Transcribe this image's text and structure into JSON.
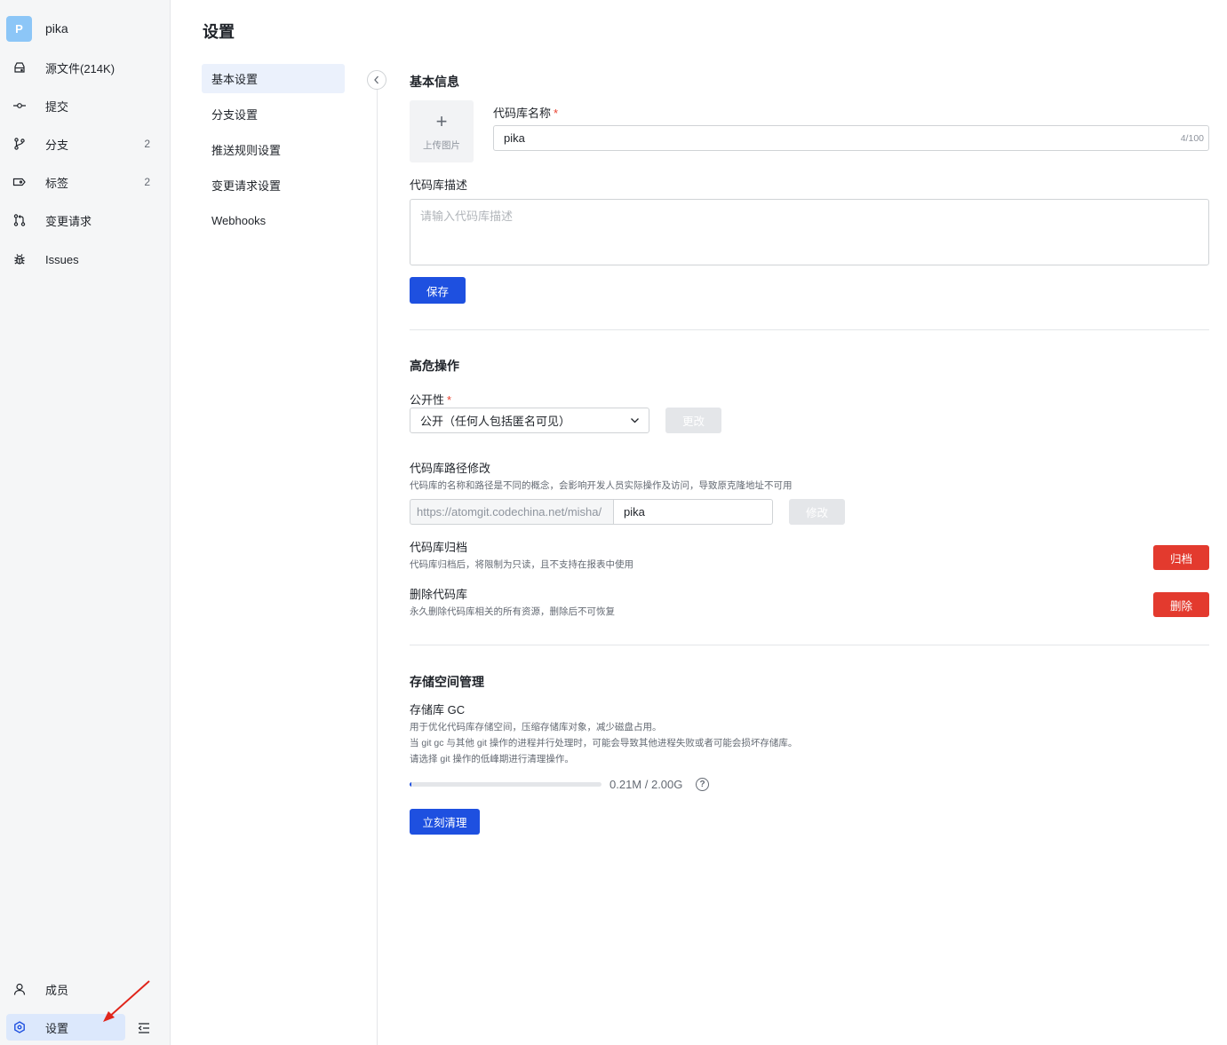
{
  "sidebar": {
    "repo": {
      "avatar_letter": "P",
      "name": "pika"
    },
    "items": [
      {
        "label": "源文件(214K)",
        "count": ""
      },
      {
        "label": "提交",
        "count": ""
      },
      {
        "label": "分支",
        "count": "2"
      },
      {
        "label": "标签",
        "count": "2"
      },
      {
        "label": "变更请求",
        "count": ""
      },
      {
        "label": "Issues",
        "count": ""
      }
    ],
    "bottom": [
      {
        "label": "成员"
      },
      {
        "label": "设置"
      }
    ]
  },
  "page": {
    "title": "设置"
  },
  "subnav": [
    {
      "label": "基本设置",
      "active": true
    },
    {
      "label": "分支设置"
    },
    {
      "label": "推送规则设置"
    },
    {
      "label": "变更请求设置"
    },
    {
      "label": "Webhooks"
    }
  ],
  "basic": {
    "title": "基本信息",
    "upload_plus": "+",
    "upload_label": "上传图片",
    "name_label": "代码库名称",
    "required_mark": "*",
    "name_value": "pika",
    "name_counter": "4/100",
    "desc_label": "代码库描述",
    "desc_placeholder": "请输入代码库描述",
    "save_label": "保存"
  },
  "danger": {
    "title": "高危操作",
    "visibility_label": "公开性",
    "visibility_value": "公开（任何人包括匿名可见）",
    "change_label": "更改",
    "path_title": "代码库路径修改",
    "path_hint": "代码库的名称和路径是不同的概念，会影响开发人员实际操作及访问，导致原克隆地址不可用",
    "path_prefix": "https://atomgit.codechina.net/misha/",
    "path_value": "pika",
    "path_button": "修改",
    "archive_title": "代码库归档",
    "archive_hint": "代码库归档后，将限制为只读，且不支持在报表中使用",
    "archive_button": "归档",
    "delete_title": "删除代码库",
    "delete_hint": "永久删除代码库相关的所有资源，删除后不可恢复",
    "delete_button": "删除"
  },
  "storage": {
    "title": "存储空间管理",
    "gc_title": "存储库 GC",
    "gc_hint_1": "用于优化代码库存储空间，压缩存储库对象，减少磁盘占用。",
    "gc_hint_2": "当 git gc 与其他 git 操作的进程并行处理时，可能会导致其他进程失败或者可能会损坏存储库。",
    "gc_hint_3": "请选择 git 操作的低峰期进行清理操作。",
    "usage_text": "0.21M / 2.00G",
    "usage_fraction": 0.0001,
    "help_glyph": "?",
    "clean_button": "立刻清理"
  },
  "colors": {
    "primary": "#1e50e0",
    "danger": "#e33a2e",
    "active_nav": "#dce8fc",
    "annotation_arrow": "#e0251b"
  }
}
